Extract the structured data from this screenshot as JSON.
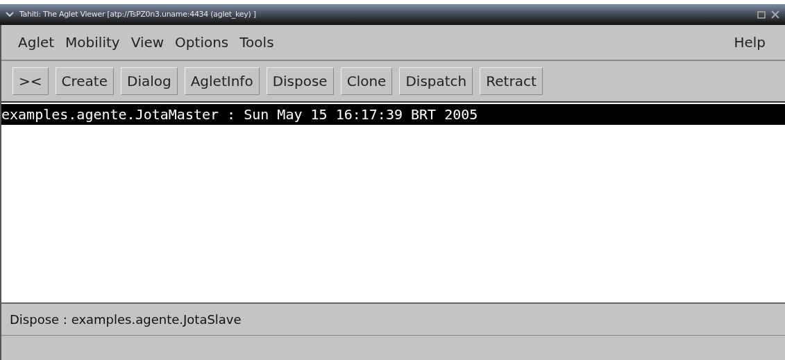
{
  "window": {
    "title": "Tahiti: The Aglet Viewer [atp://TsPZ0n3.uname:4434 (aglet_key) ]"
  },
  "menu": [
    "Aglet",
    "Mobility",
    "View",
    "Options",
    "Tools"
  ],
  "help_menu": "Help",
  "toolbar": [
    "><",
    "Create",
    "Dialog",
    "AgletInfo",
    "Dispose",
    "Clone",
    "Dispatch",
    "Retract"
  ],
  "list": [
    {
      "text": "examples.agente.JotaMaster : Sun May 15 16:17:39 BRT 2005",
      "selected": true
    }
  ],
  "status_bar": "Dispose : examples.agente.JotaSlave"
}
